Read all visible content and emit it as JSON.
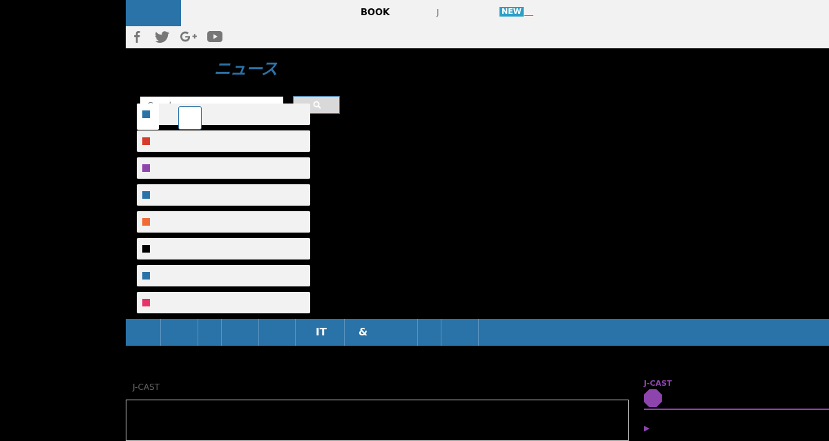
{
  "header": {
    "nav_book": "BOOK",
    "nav_j": "J",
    "new_badge": "NEW"
  },
  "social": {
    "facebook": "facebook-icon",
    "twitter": "twitter-icon",
    "googleplus": "google-plus-icon",
    "youtube": "youtube-icon"
  },
  "site": {
    "title": "ニュース"
  },
  "search": {
    "placeholder": "Google"
  },
  "categories": [
    {
      "color": "#2a73a8"
    },
    {
      "color": "#d63a2a"
    },
    {
      "color": "#8e44ad"
    },
    {
      "color": "#2a73a8"
    },
    {
      "color": "#f06a35"
    },
    {
      "color": "#000000"
    },
    {
      "color": "#2a73a8"
    },
    {
      "color": "#e8336a"
    }
  ],
  "navbar": {
    "it": "IT",
    "amp": "&"
  },
  "content": {
    "left_label": "J-CAST",
    "right_label": "J-CAST",
    "arrow": "▶"
  },
  "colors": {
    "brand": "#2a73a8",
    "accent_purple": "#8e44ad",
    "new_badge": "#2aa0c8"
  }
}
